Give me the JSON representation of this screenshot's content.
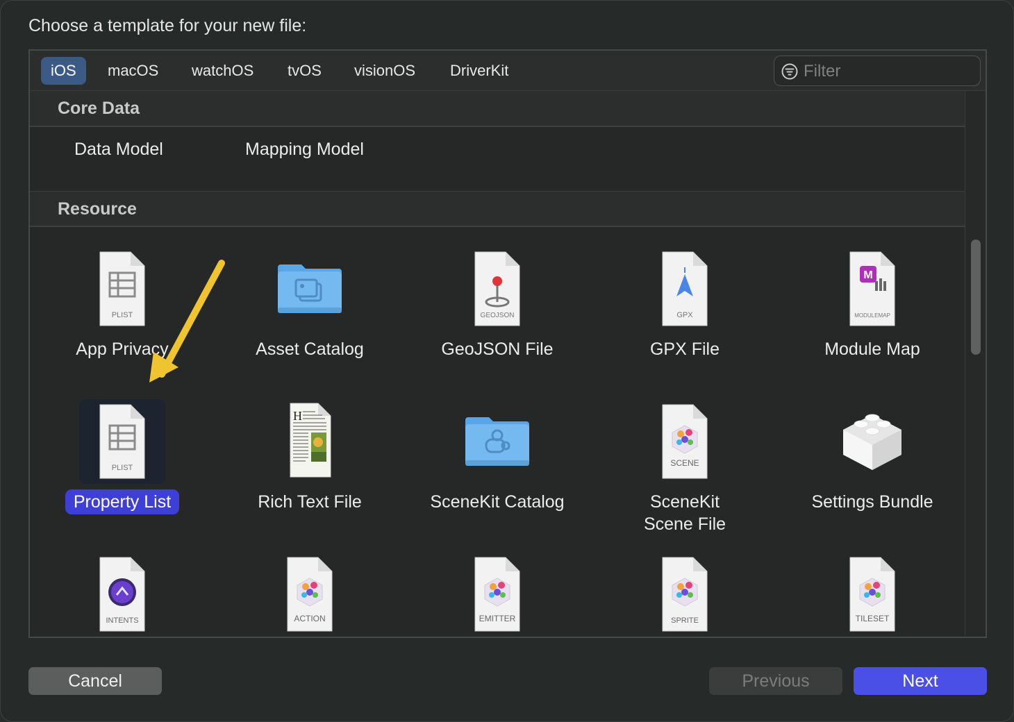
{
  "dialog": {
    "prompt": "Choose a template for your new file:"
  },
  "tabs": [
    {
      "label": "iOS",
      "active": true
    },
    {
      "label": "macOS",
      "active": false
    },
    {
      "label": "watchOS",
      "active": false
    },
    {
      "label": "tvOS",
      "active": false
    },
    {
      "label": "visionOS",
      "active": false
    },
    {
      "label": "DriverKit",
      "active": false
    }
  ],
  "filter": {
    "placeholder": "Filter",
    "value": ""
  },
  "sections": [
    {
      "title": "Core Data",
      "items": [
        "Data Model",
        "Mapping Model"
      ]
    },
    {
      "title": "Resource",
      "items": [
        {
          "label": "App Privacy",
          "icon": "plist-file-icon",
          "badge": "PLIST"
        },
        {
          "label": "Asset Catalog",
          "icon": "asset-folder-icon"
        },
        {
          "label": "GeoJSON File",
          "icon": "geojson-file-icon",
          "badge": "GEOJSON"
        },
        {
          "label": "GPX File",
          "icon": "gpx-file-icon",
          "badge": "GPX"
        },
        {
          "label": "Module Map",
          "icon": "modulemap-file-icon",
          "badge": "MODULEMAP"
        },
        {
          "label": "Property List",
          "icon": "plist-file-icon",
          "badge": "PLIST",
          "selected": true
        },
        {
          "label": "Rich Text File",
          "icon": "rtf-file-icon"
        },
        {
          "label": "SceneKit Catalog",
          "icon": "scenekit-folder-icon"
        },
        {
          "label": "SceneKit Scene File",
          "icon": "scene-file-icon",
          "badge": "SCENE"
        },
        {
          "label": "Settings Bundle",
          "icon": "lego-brick-icon"
        },
        {
          "label": "",
          "icon": "intents-file-icon",
          "badge": "INTENTS"
        },
        {
          "label": "",
          "icon": "action-file-icon",
          "badge": "ACTION"
        },
        {
          "label": "",
          "icon": "emitter-file-icon",
          "badge": "EMITTER"
        },
        {
          "label": "",
          "icon": "sprite-file-icon",
          "badge": "SPRITE"
        },
        {
          "label": "",
          "icon": "tileset-file-icon",
          "badge": "TILESET"
        }
      ]
    }
  ],
  "buttons": {
    "cancel": "Cancel",
    "previous": "Previous",
    "next": "Next"
  },
  "colors": {
    "accent": "#4a50e6",
    "selection": "#3e3fd6",
    "annotation_arrow": "#f0c330"
  }
}
